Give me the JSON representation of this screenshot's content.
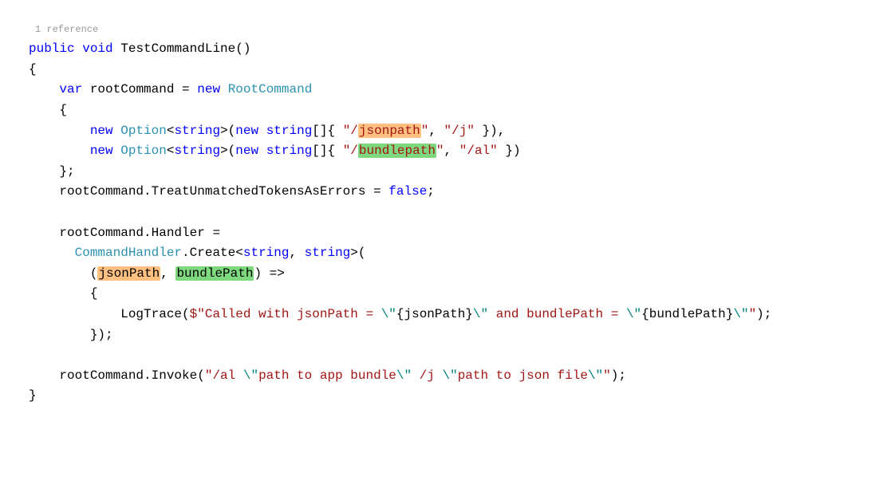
{
  "reference_hint": "1 reference",
  "code": {
    "l1": {
      "kw1": "public",
      "kw2": "void",
      "method": "TestCommandLine",
      "rest": "()"
    },
    "l2": "{",
    "l3": {
      "kw_var": "var",
      "name": "rootCommand ",
      "eq": "=",
      "kw_new": "new",
      "type": "RootCommand"
    },
    "l4": "    {",
    "l5": {
      "kw_new": "new",
      "type": "Option",
      "generic_open": "<",
      "kw_string": "string",
      "generic_close": ">(",
      "kw_new2": "new",
      "kw_string2": "string",
      "brackets": "[]{ ",
      "str1a": "\"/",
      "hl1": "jsonpath",
      "str1b": "\"",
      "comma": ", ",
      "str2": "\"/j\"",
      "end": " }),"
    },
    "l6": {
      "kw_new": "new",
      "type": "Option",
      "generic_open": "<",
      "kw_string": "string",
      "generic_close": ">(",
      "kw_new2": "new",
      "kw_string2": "string",
      "brackets": "[]{ ",
      "str1a": "\"/",
      "hl1": "bundlepath",
      "str1b": "\"",
      "comma": ", ",
      "str2": "\"/al\"",
      "end": " })"
    },
    "l7": "    };",
    "l8": {
      "text": "    rootCommand.TreatUnmatchedTokensAsErrors ",
      "eq": "=",
      "kw_false": " false",
      "semi": ";"
    },
    "l9": "",
    "l10": {
      "text": "    rootCommand.Handler ",
      "eq": "="
    },
    "l11": {
      "type": "CommandHandler",
      "text1": ".Create",
      "lt": "<",
      "kw_string": "string",
      "comma": ", ",
      "kw_string2": "string",
      "gt": ">",
      "paren": "("
    },
    "l12": {
      "open": "(",
      "hl1": "jsonPath",
      "comma": ", ",
      "hl2": "bundlePath",
      "close": ") ",
      "arrow": "=>"
    },
    "l13": "        {",
    "l14": {
      "text1": "            LogTrace(",
      "dollar": "$\"Called with jsonPath = ",
      "esc1": "\\\"",
      "interp1": "{jsonPath}",
      "esc2": "\\\"",
      "str2": " and bundlePath = ",
      "esc3": "\\\"",
      "interp2": "{bundlePath}",
      "esc4": "\\\"",
      "strEnd": "\"",
      "end": ");"
    },
    "l15": "        });",
    "l16": "",
    "l17": {
      "text": "    rootCommand.Invoke(",
      "str": "\"/al ",
      "esc1": "\\\"",
      "str2": "path to app bundle",
      "esc2": "\\\"",
      "str3": " /j ",
      "esc3": "\\\"",
      "str4": "path to json file",
      "esc4": "\\\"",
      "strEnd": "\"",
      "end": ");"
    },
    "l18": "}"
  }
}
